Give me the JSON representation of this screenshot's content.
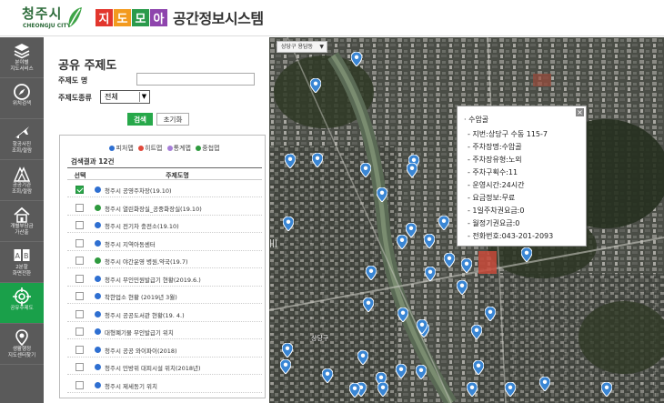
{
  "header": {
    "logo_text": "청주시",
    "logo_sub": "CHEONGJU CITY",
    "brand_chars": [
      "지",
      "도",
      "모",
      "아"
    ],
    "brand_colors": [
      "#e2362d",
      "#f39a1e",
      "#2a9a4b",
      "#8e44ad"
    ],
    "brand_title": "공간정보시스템"
  },
  "sidebar": {
    "items": [
      {
        "label": "분야별\n지도서비스",
        "icon": "layers-icon"
      },
      {
        "label": "위치검색",
        "icon": "compass-icon"
      },
      {
        "label": "항공사진\n조회/절람",
        "icon": "airplane-icon"
      },
      {
        "label": "공공기관\n조회/절람",
        "icon": "building-icon"
      },
      {
        "label": "개별부담금\n가산출",
        "icon": "house-icon"
      },
      {
        "label": "2분할\n화면전환",
        "icon": "split-screen-icon"
      },
      {
        "label": "공유주제도",
        "icon": "target-icon"
      },
      {
        "label": "생활행정\n지도센터찾기",
        "icon": "map-pin-icon"
      }
    ],
    "active_index": 6
  },
  "panel": {
    "title": "공유 주제도",
    "name_label": "주제도 명",
    "name_value": "",
    "type_label": "주제도종류",
    "type_value": "전체",
    "search_button": "검색",
    "reset_button": "초기화",
    "legend": [
      {
        "label": "피처맵",
        "color": "#2e6fd1"
      },
      {
        "label": "히트맵",
        "color": "#e0483a"
      },
      {
        "label": "통계맵",
        "color": "#a77fd9"
      },
      {
        "label": "중첩맵",
        "color": "#2e9a3e"
      }
    ],
    "result_count": "검색결과 12건",
    "col_select": "선택",
    "col_name": "주제도명",
    "rows": [
      {
        "name": "청주시 공영주차장(19.10)",
        "color": "#2e6fd1",
        "checked": true
      },
      {
        "name": "청주시 열린화장실_공중화장실(19.10)",
        "color": "#2e9a3e",
        "checked": false
      },
      {
        "name": "청주시 전기차 충전소(19.10)",
        "color": "#2e6fd1",
        "checked": false
      },
      {
        "name": "청주시 지역아동센터",
        "color": "#2e6fd1",
        "checked": false
      },
      {
        "name": "청주시 야간운영 병원,약국(19.7)",
        "color": "#2e9a3e",
        "checked": false
      },
      {
        "name": "청주시 무인민원발급기 현황(2019.6.)",
        "color": "#2e6fd1",
        "checked": false
      },
      {
        "name": "착한업소 현황 (2019년 3월)",
        "color": "#2e6fd1",
        "checked": false
      },
      {
        "name": "청주시 공공도서관 현황(19. 4.)",
        "color": "#2e6fd1",
        "checked": false
      },
      {
        "name": "대형폐기물 무인발급기 위치",
        "color": "#2e6fd1",
        "checked": false
      },
      {
        "name": "청주시 공공 와이파이(2018)",
        "color": "#2e6fd1",
        "checked": false
      },
      {
        "name": "청주시 민방위 대피시설 위치(2018년)",
        "color": "#2e6fd1",
        "checked": false
      },
      {
        "name": "청주시 제세동기 위치",
        "color": "#2e6fd1",
        "checked": false
      }
    ]
  },
  "map": {
    "region_select": "상당구 용담동",
    "popup": {
      "title": "· 수암골",
      "lines": [
        "- 지번:상당구 수동 115-7",
        "- 주차장명:수암골",
        "- 주차장유형:노외",
        "- 주차구획수:11",
        "- 운영시간:24시간",
        "- 요금정보:무료",
        "- 1일주차권요금:0",
        "- 월정기권요금:0",
        "- 전화번호:043-201-2093"
      ]
    },
    "labels": [
      "상당구"
    ]
  }
}
